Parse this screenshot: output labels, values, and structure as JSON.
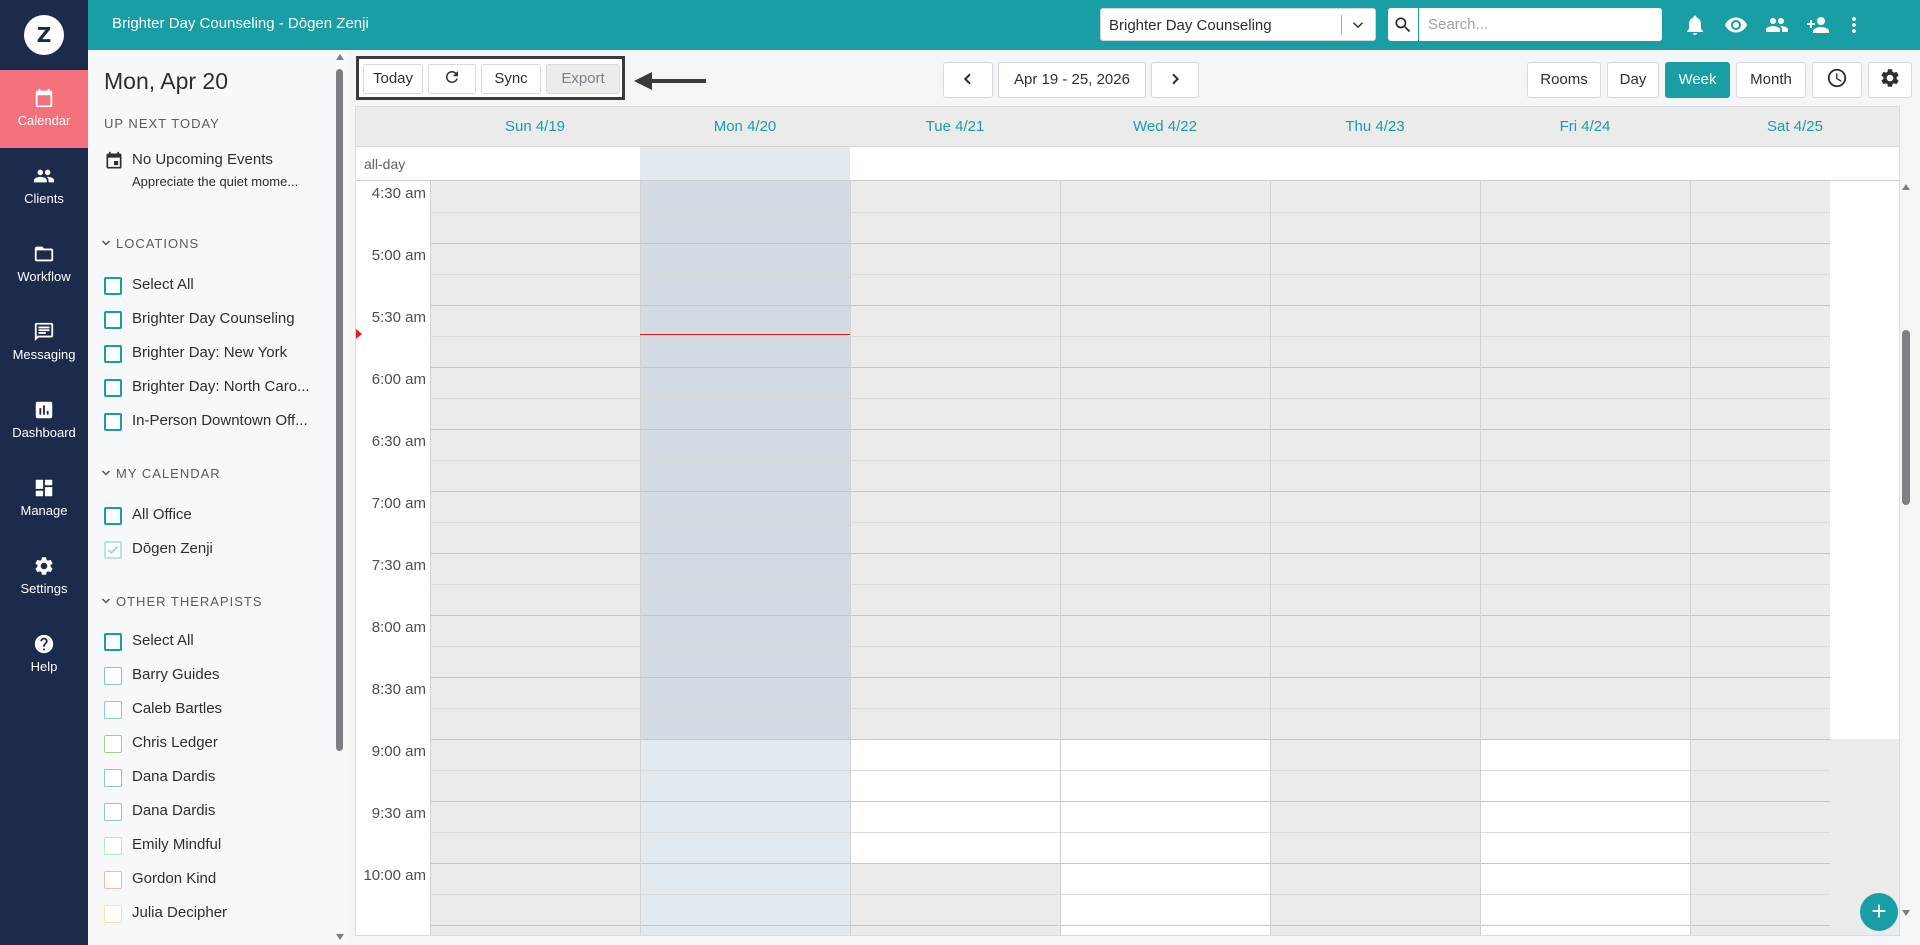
{
  "nav": {
    "logo": "Z",
    "items": [
      {
        "label": "Calendar",
        "icon": "calendar-icon",
        "active": true
      },
      {
        "label": "Clients",
        "icon": "clients-icon"
      },
      {
        "label": "Workflow",
        "icon": "folder-icon"
      },
      {
        "label": "Messaging",
        "icon": "message-icon"
      },
      {
        "label": "Dashboard",
        "icon": "chart-icon"
      },
      {
        "label": "Manage",
        "icon": "grid-icon"
      },
      {
        "label": "Settings",
        "icon": "gear-icon"
      },
      {
        "label": "Help",
        "icon": "help-icon"
      }
    ]
  },
  "topbar": {
    "title": "Brighter Day Counseling - Dōgen Zenji",
    "location_value": "Brighter Day Counseling",
    "search_placeholder": "Search...",
    "icons": [
      "bell-icon",
      "eye-icon",
      "people-icon",
      "add-person-icon",
      "more-vert-icon"
    ]
  },
  "sidebar": {
    "date": "Mon, Apr 20",
    "up_next_heading": "UP NEXT TODAY",
    "up_next_title": "No Upcoming Events",
    "up_next_sub": "Appreciate the quiet mome...",
    "locations": {
      "heading": "LOCATIONS",
      "items": [
        "Select All",
        "Brighter Day Counseling",
        "Brighter Day: New York",
        "Brighter Day: North Caro...",
        "In-Person Downtown Off..."
      ]
    },
    "my_calendar": {
      "heading": "MY CALENDAR",
      "items": [
        "All Office",
        "Dōgen Zenji"
      ]
    },
    "other_therapists": {
      "heading": "OTHER THERAPISTS",
      "items": [
        "Select All",
        "Barry Guides",
        "Caleb Bartles",
        "Chris Ledger",
        "Dana Dardis",
        "Dana Dardis",
        "Emily Mindful",
        "Gordon Kind",
        "Julia Decipher"
      ]
    }
  },
  "toolbar": {
    "today": "Today",
    "sync": "Sync",
    "export": "Export",
    "range": "Apr 19 - 25, 2026",
    "views": {
      "rooms": "Rooms",
      "day": "Day",
      "week": "Week",
      "month": "Month"
    },
    "active_view": "Week"
  },
  "calendar": {
    "days": [
      "Sun 4/19",
      "Mon 4/20",
      "Tue 4/21",
      "Wed 4/22",
      "Thu 4/23",
      "Fri 4/24",
      "Sat 4/25"
    ],
    "allday_label": "all-day",
    "times": [
      "4:30 am",
      "5:00 am",
      "5:30 am",
      "6:00 am",
      "6:30 am",
      "7:00 am",
      "7:30 am",
      "8:00 am",
      "8:30 am",
      "9:00 am",
      "9:30 am",
      "10:00 am"
    ],
    "today_index": 1
  },
  "colors": {
    "teal": "#1a9ea6",
    "nav_bg": "#1c2b4c",
    "nav_active": "#f2717a",
    "unavailable": "#ebebeb",
    "today_col": "#d4dbe2",
    "today_col_light": "#e2eaf0",
    "now_line": "#e02020"
  }
}
